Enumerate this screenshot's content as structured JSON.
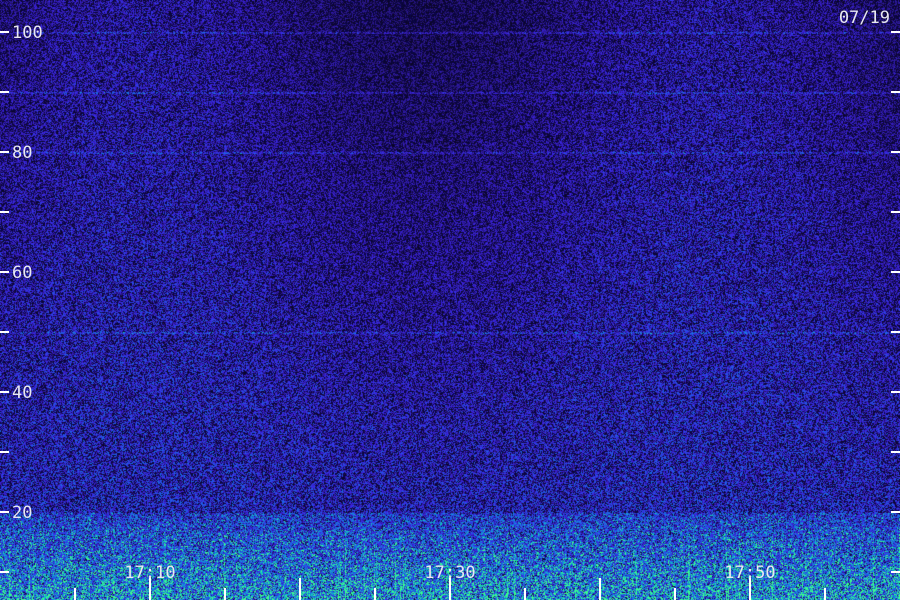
{
  "chart_data": {
    "type": "heatmap",
    "title": "",
    "xlabel": "",
    "ylabel": "",
    "date_label": "07/19",
    "y_ticks_major": [
      {
        "value": 20,
        "label": "20"
      },
      {
        "value": 40,
        "label": "40"
      },
      {
        "value": 60,
        "label": "60"
      },
      {
        "value": 80,
        "label": "80"
      },
      {
        "value": 100,
        "label": "100"
      }
    ],
    "y_ticks_minor": [
      10,
      30,
      50,
      70,
      90
    ],
    "ylim": [
      10,
      100
    ],
    "x_ticks_major": [
      {
        "value": "17:10",
        "label": "17:10"
      },
      {
        "value": "17:30",
        "label": "17:30"
      },
      {
        "value": "17:50",
        "label": "17:50"
      }
    ],
    "x_tick_minutes": [
      17.05,
      17.1,
      17.15,
      17.2,
      17.25,
      17.3,
      17.35,
      17.4,
      17.45,
      17.5,
      17.55
    ],
    "colormap": [
      "#000000",
      "#1a0a50",
      "#2a14a0",
      "#3838e0",
      "#30c8e8",
      "#40ff90"
    ],
    "features": {
      "hum_lines": [
        100,
        90,
        80,
        50
      ],
      "strong_band_below": 20
    }
  }
}
